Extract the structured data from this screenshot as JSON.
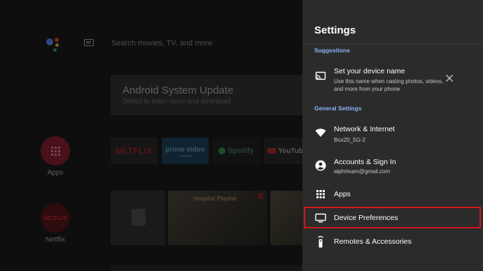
{
  "home": {
    "search_placeholder": "Search movies, TV, and more",
    "update_title": "Android System Update",
    "update_subtitle": "Select to learn more and download",
    "apps_label": "Apps",
    "netflix_label": "Netflix",
    "tiles": [
      "NETFLIX",
      "prime video",
      "Spotify",
      "YouTube"
    ],
    "netflix_circle_text": "NETFLIX",
    "thumb_text": "Hospital Playlist"
  },
  "settings": {
    "title": "Settings",
    "suggestions_label": "Suggestions",
    "suggestion": {
      "title": "Set your device name",
      "description_line1": "Use this name when casting photos, videos,",
      "description_line2": "and more from your phone"
    },
    "general_label": "General Settings",
    "items": [
      {
        "label": "Network & Internet",
        "sub": "Box20_5G-2",
        "icon": "wifi-icon"
      },
      {
        "label": "Accounts & Sign In",
        "sub": "alphrteam@gmail.com",
        "icon": "account-icon"
      },
      {
        "label": "Apps",
        "sub": "",
        "icon": "apps-grid-icon"
      },
      {
        "label": "Device Preferences",
        "sub": "",
        "icon": "tv-icon",
        "highlighted": true
      },
      {
        "label": "Remotes & Accessories",
        "sub": "",
        "icon": "remote-icon"
      }
    ]
  },
  "colors": {
    "panel_bg": "#2b2b2b",
    "section_accent": "#8ab4f8",
    "highlight_border": "#d0161b"
  }
}
